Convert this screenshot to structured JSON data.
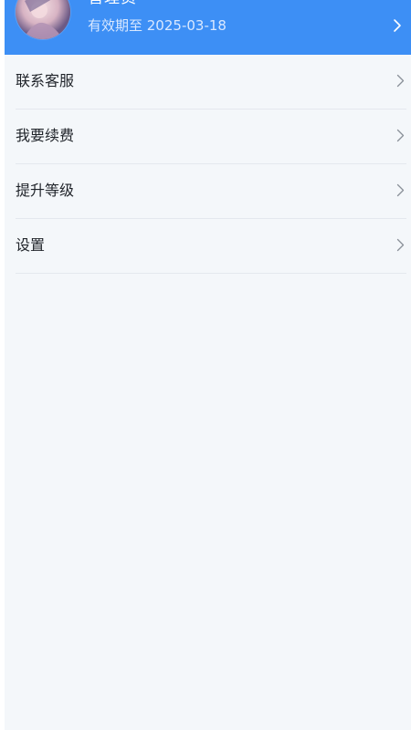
{
  "header": {
    "user_name": "管理员",
    "expiry": "有效期至 2025-03-18",
    "accent_color": "#3d8ff5",
    "avatar_icon": "user-avatar-image",
    "chevron_icon": "chevron-right-icon"
  },
  "menu": {
    "items": [
      {
        "label": "联系客服",
        "icon": "chevron-right-icon"
      },
      {
        "label": "我要续费",
        "icon": "chevron-right-icon"
      },
      {
        "label": "提升等级",
        "icon": "chevron-right-icon"
      },
      {
        "label": "设置",
        "icon": "chevron-right-icon"
      }
    ]
  },
  "colors": {
    "page_background": "#f4f7fa",
    "divider": "#e4e8ee",
    "text": "#1f2329"
  }
}
